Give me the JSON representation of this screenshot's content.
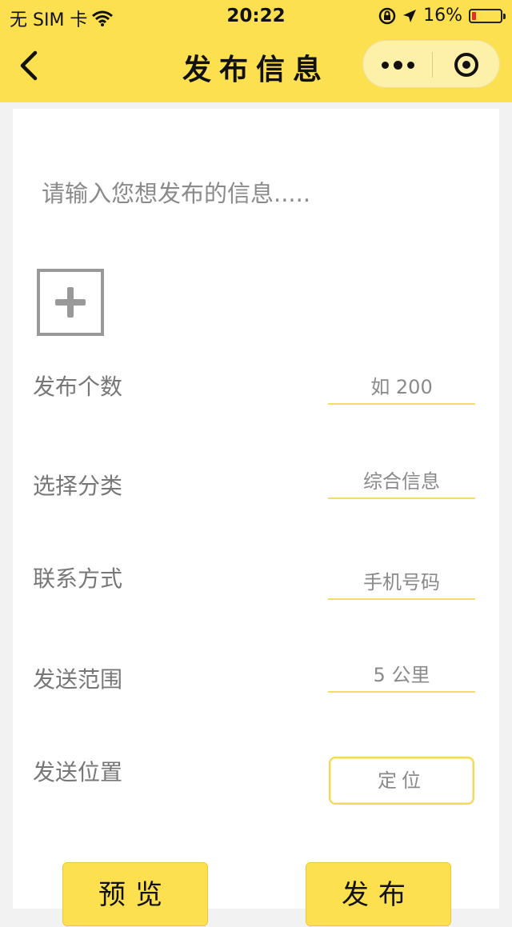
{
  "status_bar": {
    "carrier": "无 SIM 卡",
    "time": "20:22",
    "battery": "16%",
    "battery_level": 0.16
  },
  "nav": {
    "title": "发布信息"
  },
  "form": {
    "message_placeholder": "请输入您想发布的信息.....",
    "rows": [
      {
        "label": "发布个数",
        "value": "如 200"
      },
      {
        "label": "选择分类",
        "value": "综合信息"
      },
      {
        "label": "联系方式",
        "value": "手机号码"
      },
      {
        "label": "发送范围",
        "value": "5 公里"
      },
      {
        "label": "发送位置",
        "value": "定位"
      }
    ]
  },
  "buttons": {
    "preview": "预览",
    "publish": "发布"
  },
  "colors": {
    "brand_yellow": "#fce04f",
    "battery_low": "#e0302c"
  }
}
